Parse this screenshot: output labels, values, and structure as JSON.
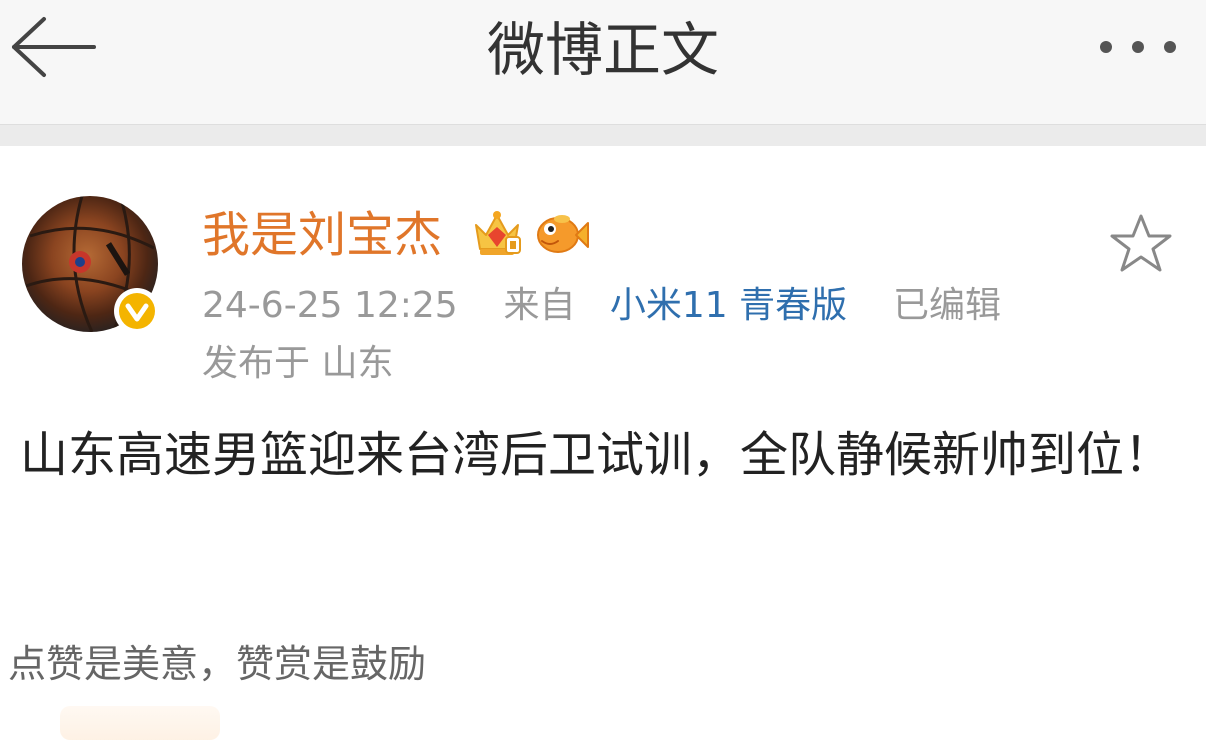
{
  "header": {
    "title": "微博正文",
    "back_icon": "arrow-left-icon",
    "more_icon": "more-dots-icon"
  },
  "post": {
    "author": {
      "name": "我是刘宝杰",
      "avatar": "basketball-avatar",
      "badges": [
        "crown-icon",
        "fish-icon"
      ],
      "verified_icon": "verified-v-icon",
      "name_color": "#e0762a"
    },
    "timestamp": "24-6-25 12:25",
    "source_prefix": "来自",
    "source": "小米11 青春版",
    "edited": "已编辑",
    "location": "发布于 山东",
    "text": "山东高速男篮迎来台湾后卫试训，全队静候新帅到位！",
    "favorite_icon": "star-outline-icon"
  },
  "appreciation": {
    "text": "点赞是美意，赞赏是鼓励"
  },
  "colors": {
    "accent_link": "#2f6fae",
    "meta_gray": "#999999",
    "header_bg": "#f7f7f7"
  }
}
